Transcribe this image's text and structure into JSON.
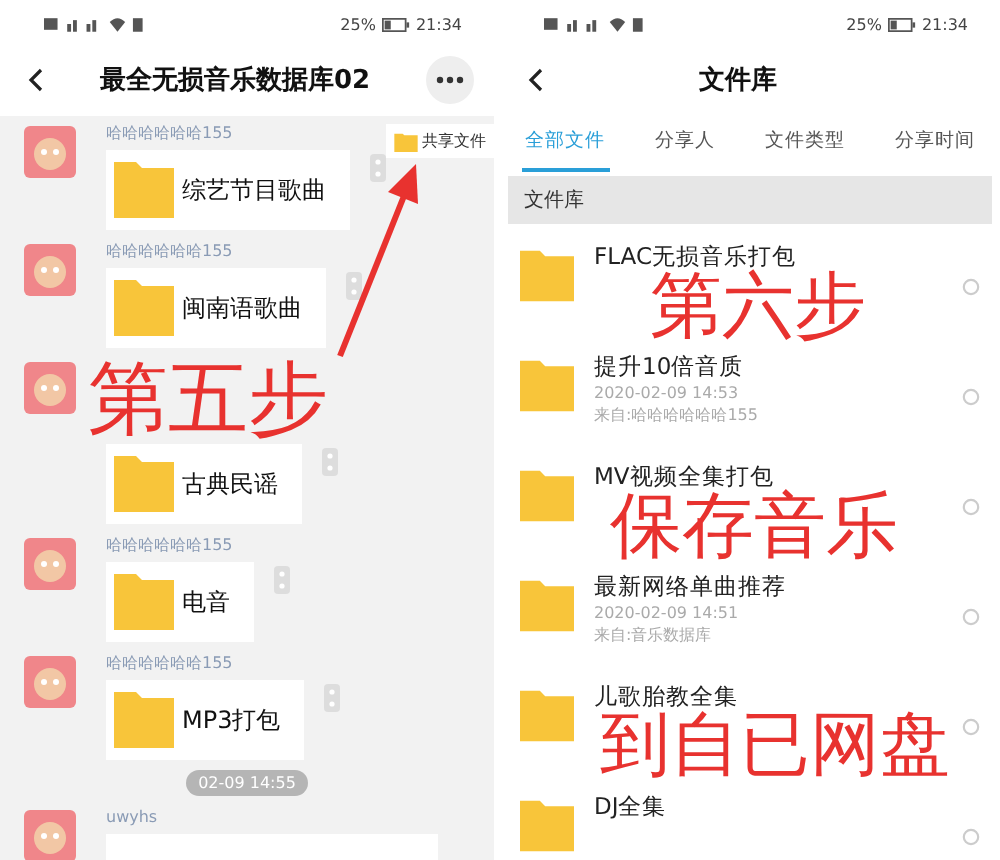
{
  "left": {
    "status_bar": {
      "battery": "25%",
      "time": "21:34"
    },
    "title": "最全无损音乐数据库02",
    "share_button": "共享文件",
    "messages": [
      {
        "kind": "file",
        "sender": "哈哈哈哈哈哈155",
        "file": "综艺节目歌曲"
      },
      {
        "kind": "file",
        "sender": "哈哈哈哈哈哈155",
        "file": "闽南语歌曲"
      },
      {
        "kind": "file",
        "file": "古典民谣"
      },
      {
        "kind": "file",
        "sender": "哈哈哈哈哈哈155",
        "file": "电音"
      },
      {
        "kind": "file",
        "sender": "哈哈哈哈哈哈155",
        "file": "MP3打包"
      },
      {
        "kind": "time",
        "text": "02-09 14:55"
      },
      {
        "kind": "partial",
        "sender": "uwyhs"
      }
    ]
  },
  "right": {
    "status_bar": {
      "battery": "25%",
      "time": "21:34"
    },
    "title": "文件库",
    "tabs": [
      {
        "label": "全部文件",
        "selected": true
      },
      {
        "label": "分享人",
        "selected": false
      },
      {
        "label": "文件类型",
        "selected": false
      },
      {
        "label": "分享时间",
        "selected": false
      }
    ],
    "section": "文件库",
    "files": [
      {
        "name": "FLAC无损音乐打包"
      },
      {
        "name": "提升10倍音质",
        "date": "2020-02-09  14:53",
        "from": "来自:哈哈哈哈哈哈155"
      },
      {
        "name": "MV视频全集打包"
      },
      {
        "name": "最新网络单曲推荐",
        "date": "2020-02-09  14:51",
        "from": "来自:音乐数据库"
      },
      {
        "name": "儿歌胎教全集"
      },
      {
        "name": "DJ全集"
      }
    ]
  },
  "annotations": [
    "第五步",
    "第六步",
    "保存音乐",
    "到自已网盘"
  ]
}
